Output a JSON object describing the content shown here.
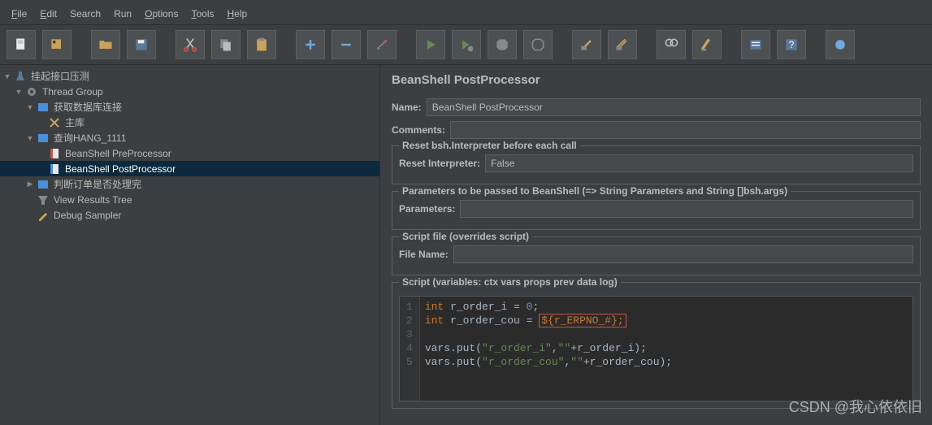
{
  "titlebar": "  ",
  "menu": {
    "file": "File",
    "edit": "Edit",
    "search": "Search",
    "run": "Run",
    "options": "Options",
    "tools": "Tools",
    "help": "Help"
  },
  "tree": {
    "root": "挂起接口压测",
    "threadgroup": "Thread Group",
    "dbconn": "获取数据库连接",
    "mainlib": "主库",
    "queryhang": "查询HANG_1111",
    "bsh_pre": "BeanShell PreProcessor",
    "bsh_post": "BeanShell PostProcessor",
    "judge": "判断订单是否处理完",
    "viewresults": "View Results Tree",
    "debug": "Debug Sampler"
  },
  "panel": {
    "title": "BeanShell PostProcessor",
    "name_label": "Name:",
    "name_value": "BeanShell PostProcessor",
    "comments_label": "Comments:",
    "comments_value": "",
    "g1_title": "Reset bsh.Interpreter before each call",
    "reset_label": "Reset Interpreter:",
    "reset_value": "False",
    "g2_title": "Parameters to be passed to BeanShell (=> String Parameters and String []bsh.args)",
    "params_label": "Parameters:",
    "params_value": "",
    "g3_title": "Script file (overrides script)",
    "filename_label": "File Name:",
    "filename_value": "",
    "g4_title": "Script (variables: ctx vars props prev data log)",
    "code": {
      "l1a": "int",
      "l1b": " r_order_i = ",
      "l1c": "0",
      "l1d": ";",
      "l2a": "int",
      "l2b": " r_order_cou = ",
      "l2c": "${",
      "l2d": "r_ERPNO_#",
      "l2e": "};",
      "l4a": "vars.put(",
      "l4b": "\"r_order_i\"",
      "l4c": ",",
      "l4d": "\"\"",
      "l4e": "+r_order_i);",
      "l5a": "vars.put(",
      "l5b": "\"r_order_cou\"",
      "l5c": ",",
      "l5d": "\"\"",
      "l5e": "+r_order_cou);"
    }
  },
  "watermark": "CSDN @我心依依旧"
}
